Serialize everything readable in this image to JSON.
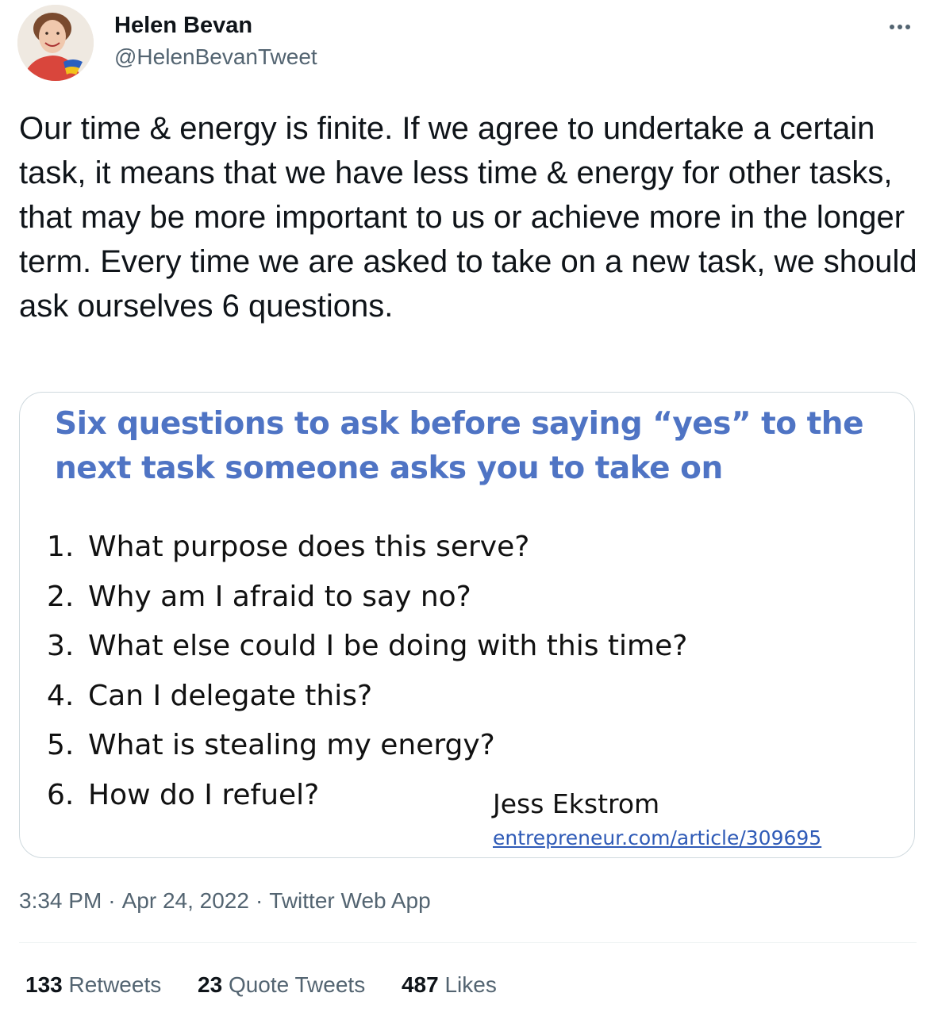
{
  "author": {
    "name": "Helen Bevan",
    "handle": "@HelenBevanTweet",
    "avatar_icon": "profile-photo"
  },
  "menu": {
    "more_icon": "more-horizontal-icon",
    "more_label": "···"
  },
  "tweet": {
    "text": "Our time & energy is finite. If we agree to undertake a certain task, it means that we have less time & energy for other tasks, that may be more important to us or achieve more in the longer term. Every time we are asked to take on a new task, we should ask ourselves 6 questions."
  },
  "media": {
    "title": "Six questions to ask before saying “yes” to the next task someone asks you to take on",
    "title_color": "#4f74c4",
    "questions": [
      {
        "num": "1.",
        "text": "What purpose does this serve?"
      },
      {
        "num": "2.",
        "text": "Why am I afraid to say no?"
      },
      {
        "num": "3.",
        "text": "What else could I be doing with this time?"
      },
      {
        "num": "4.",
        "text": "Can I delegate this?"
      },
      {
        "num": "5.",
        "text": "What is stealing my energy?"
      },
      {
        "num": "6.",
        "text": "How do I refuel?"
      }
    ],
    "attribution": "Jess Ekstrom",
    "link": "entrepreneur.com/article/309695",
    "link_color": "#2f5bb7"
  },
  "meta": {
    "time": "3:34 PM",
    "date": "Apr 24, 2022",
    "source": "Twitter Web App",
    "separator": "·"
  },
  "stats": {
    "retweets_count": "133",
    "retweets_label": "Retweets",
    "quotes_count": "23",
    "quotes_label": "Quote Tweets",
    "likes_count": "487",
    "likes_label": "Likes"
  }
}
